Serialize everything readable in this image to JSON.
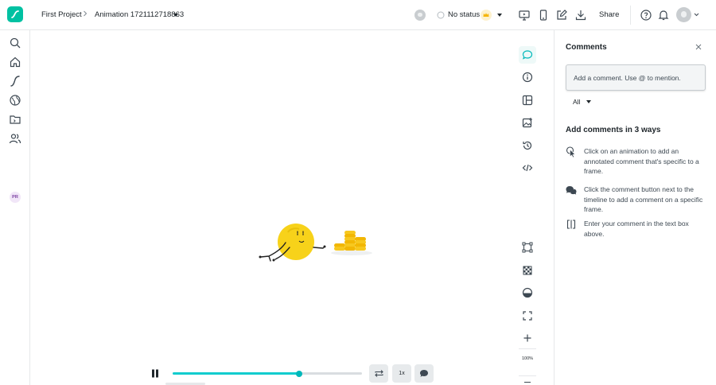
{
  "header": {
    "breadcrumb_project": "First Project",
    "breadcrumb_file": "Animation 1721112718863",
    "status_label": "No status",
    "share_label": "Share"
  },
  "playback": {
    "progress": 0.67,
    "speed_label": "1x",
    "zoom_label": "100%"
  },
  "comments_panel": {
    "title": "Comments",
    "input_placeholder": "Add a comment. Use @ to mention.",
    "filter_value": "All",
    "tips_title": "Add comments in 3 ways",
    "tips": [
      {
        "icon": "click-pointer-icon",
        "text": "Click on an animation to add an annotated comment that's specific to a frame."
      },
      {
        "icon": "comment-bubble-icon",
        "text": "Click the comment button next to the timeline to add a comment on a specific frame."
      },
      {
        "icon": "text-box-icon",
        "text": "Enter your comment in the text box above."
      }
    ]
  },
  "user": {
    "initials": "PR"
  },
  "colors": {
    "brand": "#00c1a2",
    "accent": "#0fccce",
    "premium": "#f5b400"
  }
}
